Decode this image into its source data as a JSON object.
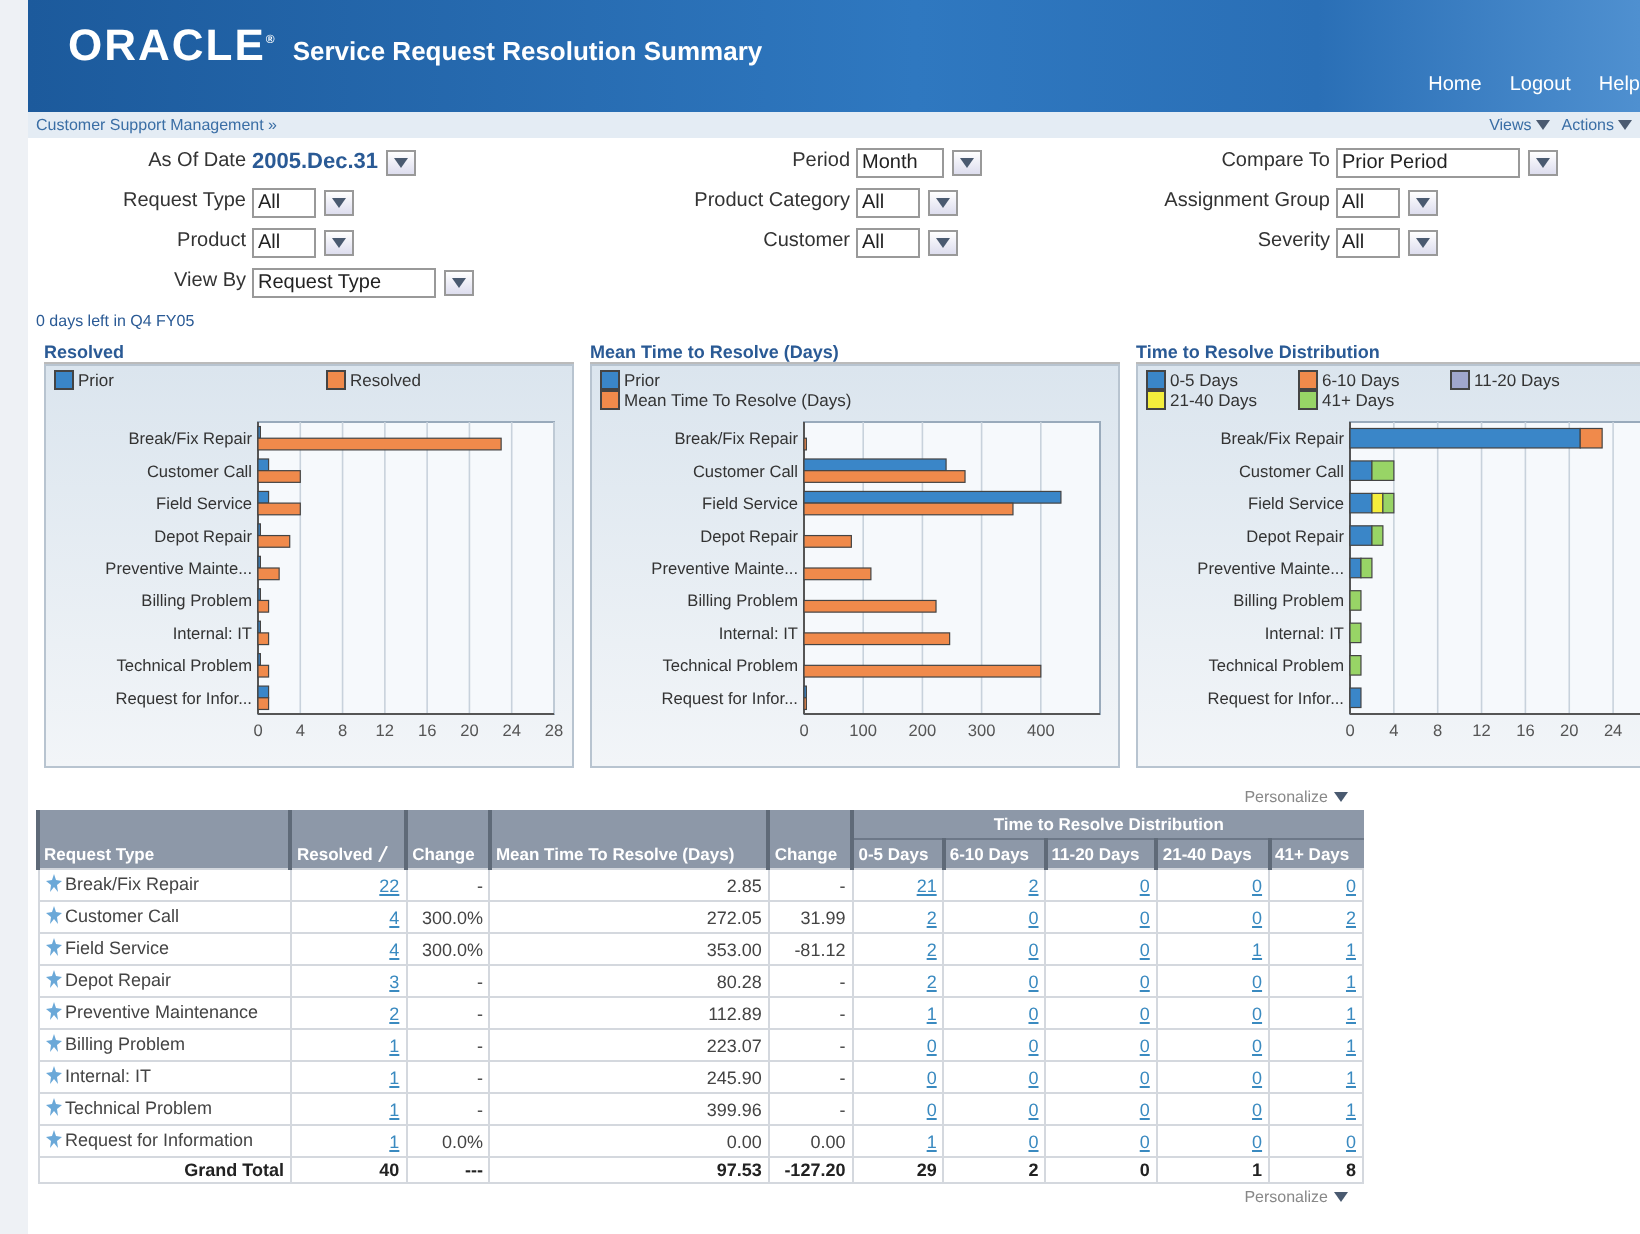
{
  "header": {
    "logo": "ORACLE$^{®}$",
    "title": "Service Request Resolution Summary",
    "nav": [
      "Home",
      "Logout",
      "Help"
    ]
  },
  "subbar": {
    "breadcrumb": "Customer Support Management »",
    "menus": [
      "Views",
      "Actions"
    ]
  },
  "filter_columns": [
    [
      {
        "label": "As Of Date",
        "kind": "date",
        "value": "2005.Dec.31"
      },
      {
        "label": "Request Type",
        "kind": "select",
        "value": "All"
      },
      {
        "label": "Product",
        "kind": "select",
        "value": "All"
      },
      {
        "label": "View By",
        "kind": "select",
        "value": "Request Type"
      }
    ],
    [
      {
        "label": "Period",
        "kind": "select",
        "value": "Month"
      },
      {
        "label": "Product Category",
        "kind": "select",
        "value": "All"
      },
      {
        "label": "Customer",
        "kind": "select",
        "value": "All"
      }
    ],
    [
      {
        "label": "Compare To",
        "kind": "select",
        "value": "Prior Period"
      },
      {
        "label": "Assignment Group",
        "kind": "select",
        "value": "All"
      },
      {
        "label": "Severity",
        "kind": "select",
        "value": "All"
      }
    ]
  ],
  "period_note": "0 days left in Q4 FY05",
  "charts": [
    {
      "chart_data": {
        "type": "bar",
        "orientation": "horizontal",
        "title": "Resolved",
        "categories": [
          "Break/Fix Repair",
          "Customer Call",
          "Field Service",
          "Depot Repair",
          "Preventive Mainte...",
          "Billing Problem",
          "Internal: IT",
          "Technical Problem",
          "Request for Infor..."
        ],
        "xlim": [
          0,
          28
        ],
        "xticks": [
          0,
          4,
          8,
          12,
          16,
          20,
          24,
          28
        ],
        "grid": true,
        "stacked": false,
        "series": [
          {
            "name": "Prior",
            "color": "#3a86c8",
            "values": [
              0,
              1,
              1,
              0,
              0,
              0,
              0,
              0,
              1
            ]
          },
          {
            "name": "Resolved",
            "color": "#f08a4b",
            "values": [
              23,
              4,
              4,
              3,
              2,
              1,
              1,
              1,
              1
            ]
          }
        ]
      }
    },
    {
      "chart_data": {
        "type": "bar",
        "orientation": "horizontal",
        "title": "Mean Time to Resolve (Days)",
        "categories": [
          "Break/Fix Repair",
          "Customer Call",
          "Field Service",
          "Depot Repair",
          "Preventive Mainte...",
          "Billing Problem",
          "Internal: IT",
          "Technical Problem",
          "Request for Infor..."
        ],
        "xlim": [
          0,
          500
        ],
        "xticks": [
          0,
          100,
          200,
          300,
          400
        ],
        "grid": true,
        "stacked": false,
        "series": [
          {
            "name": "Prior",
            "color": "#3a86c8",
            "values": [
              null,
              240,
              434,
              null,
              null,
              null,
              null,
              null,
              0
            ]
          },
          {
            "name": "Mean Time To Resolve (Days)",
            "color": "#f08a4b",
            "values": [
              3,
              272,
              353,
              80,
              113,
              223,
              246,
              400,
              0
            ]
          }
        ]
      }
    },
    {
      "chart_data": {
        "type": "bar",
        "orientation": "horizontal",
        "title": "Time to Resolve Distribution",
        "categories": [
          "Break/Fix Repair",
          "Customer Call",
          "Field Service",
          "Depot Repair",
          "Preventive Mainte...",
          "Billing Problem",
          "Internal: IT",
          "Technical Problem",
          "Request for Infor..."
        ],
        "xlim": [
          0,
          27
        ],
        "xticks": [
          0,
          4,
          8,
          12,
          16,
          20,
          24
        ],
        "grid": true,
        "stacked": true,
        "series": [
          {
            "name": "0-5 Days",
            "color": "#3a86c8",
            "values": [
              21,
              2,
              2,
              2,
              1,
              0,
              0,
              0,
              1
            ]
          },
          {
            "name": "6-10 Days",
            "color": "#f08a4b",
            "values": [
              2,
              0,
              0,
              0,
              0,
              0,
              0,
              0,
              0
            ]
          },
          {
            "name": "11-20 Days",
            "color": "#a0a6cc",
            "values": [
              0,
              0,
              0,
              0,
              0,
              0,
              0,
              0,
              0
            ]
          },
          {
            "name": "21-40 Days",
            "color": "#f4ee3c",
            "values": [
              0,
              0,
              1,
              0,
              0,
              0,
              0,
              0,
              0
            ]
          },
          {
            "name": "41+ Days",
            "color": "#98d466",
            "values": [
              0,
              2,
              1,
              1,
              1,
              1,
              1,
              1,
              0
            ]
          }
        ]
      }
    }
  ],
  "table": {
    "personalize": [
      "Personalize",
      "Personalize"
    ],
    "group_header": "Time to Resolve Distribution",
    "columns": [
      {
        "label": "Request Type",
        "kind": "text",
        "sorted": false
      },
      {
        "label": "Resolved",
        "kind": "link",
        "sorted": true
      },
      {
        "label": "Change",
        "kind": "number",
        "sorted": false
      },
      {
        "label": "Mean Time To Resolve (Days)",
        "kind": "number",
        "sorted": false
      },
      {
        "label": "Change",
        "kind": "number",
        "sorted": false
      },
      {
        "label": "0-5 Days",
        "kind": "link",
        "sorted": false
      },
      {
        "label": "6-10 Days",
        "kind": "link",
        "sorted": false
      },
      {
        "label": "11-20 Days",
        "kind": "link",
        "sorted": false
      },
      {
        "label": "21-40 Days",
        "kind": "link",
        "sorted": false
      },
      {
        "label": "41+ Days",
        "kind": "link",
        "sorted": false
      }
    ],
    "rows": [
      [
        "Break/Fix Repair",
        "22",
        "-",
        "2.85",
        "-",
        "21",
        "2",
        "0",
        "0",
        "0"
      ],
      [
        "Customer Call",
        "4",
        "300.0%",
        "272.05",
        "31.99",
        "2",
        "0",
        "0",
        "0",
        "2"
      ],
      [
        "Field Service",
        "4",
        "300.0%",
        "353.00",
        "-81.12",
        "2",
        "0",
        "0",
        "1",
        "1"
      ],
      [
        "Depot Repair",
        "3",
        "-",
        "80.28",
        "-",
        "2",
        "0",
        "0",
        "0",
        "1"
      ],
      [
        "Preventive Maintenance",
        "2",
        "-",
        "112.89",
        "-",
        "1",
        "0",
        "0",
        "0",
        "1"
      ],
      [
        "Billing Problem",
        "1",
        "-",
        "223.07",
        "-",
        "0",
        "0",
        "0",
        "0",
        "1"
      ],
      [
        "Internal: IT",
        "1",
        "-",
        "245.90",
        "-",
        "0",
        "0",
        "0",
        "0",
        "1"
      ],
      [
        "Technical Problem",
        "1",
        "-",
        "399.96",
        "-",
        "0",
        "0",
        "0",
        "0",
        "1"
      ],
      [
        "Request for Information",
        "1",
        "0.0%",
        "0.00",
        "0.00",
        "1",
        "0",
        "0",
        "0",
        "0"
      ]
    ],
    "total": [
      "Grand Total",
      "40",
      "---",
      "97.53",
      "-127.20",
      "29",
      "2",
      "0",
      "1",
      "8"
    ]
  }
}
